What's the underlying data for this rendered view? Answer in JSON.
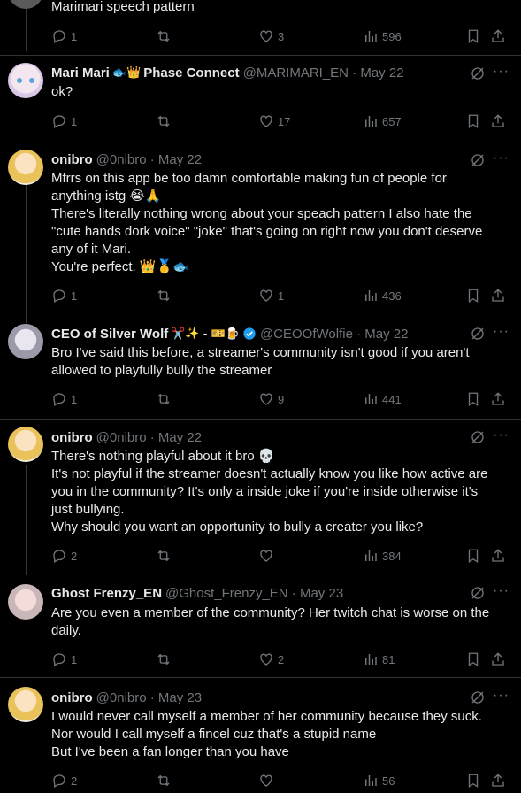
{
  "tweets": [
    {
      "id": "t0",
      "body": [
        "Marimari speech pattern"
      ],
      "stats": {
        "replies": "1",
        "reposts": "",
        "likes": "3",
        "views": "596"
      }
    },
    {
      "id": "t1",
      "name": "Mari Mari",
      "name_emoji": "🐟👑",
      "name_suffix": "Phase Connect",
      "handle": "@MARIMARI_EN · May 22",
      "body": [
        "ok?"
      ],
      "stats": {
        "replies": "1",
        "reposts": "",
        "likes": "17",
        "views": "657"
      }
    },
    {
      "id": "t2",
      "name": "onibro",
      "handle": "@0nibro · May 22",
      "body": [
        "Mfrrs on this app be too damn comfortable making fun of people for",
        "anything istg 😭🙏",
        "There's literally nothing wrong about your speach pattern I also hate the",
        "\"cute hands dork voice\" \"joke\" that's going on right now you don't deserve",
        "any of it Mari.",
        "You're perfect. 👑🥇🐟"
      ],
      "stats": {
        "replies": "1",
        "reposts": "",
        "likes": "1",
        "views": "436"
      }
    },
    {
      "id": "t3",
      "name": "CEO of Silver Wolf",
      "name_emoji": "✂️✨ - 🎫🍺",
      "verified": true,
      "handle": "@CEOOfWolfie · May 22",
      "body": [
        "Bro I've said this before, a streamer's community isn't good if you aren't",
        "allowed to playfully bully the streamer"
      ],
      "stats": {
        "replies": "1",
        "reposts": "",
        "likes": "9",
        "views": "441"
      }
    },
    {
      "id": "t4",
      "name": "onibro",
      "handle": "@0nibro · May 22",
      "body": [
        "There's nothing playful about it bro 💀",
        "It's not playful if the streamer doesn't actually know you like how active are",
        "you in the community? It's only a inside joke if you're inside otherwise it's",
        "just bullying.",
        "Why should you want an opportunity to bully a creater you like?"
      ],
      "stats": {
        "replies": "2",
        "reposts": "",
        "likes": "",
        "views": "384"
      }
    },
    {
      "id": "t5",
      "name": "Ghost Frenzy_EN",
      "handle": "@Ghost_Frenzy_EN · May 23",
      "body": [
        "Are you even a member of the community?  Her twitch chat is worse on the",
        "daily."
      ],
      "stats": {
        "replies": "1",
        "reposts": "",
        "likes": "2",
        "views": "81"
      }
    },
    {
      "id": "t6",
      "name": "onibro",
      "handle": "@0nibro · May 23",
      "body": [
        "I would never call myself a member of her community because they suck.",
        "Nor would I call myself a fincel cuz that's a stupid name",
        "But I've been a fan longer than you have"
      ],
      "stats": {
        "replies": "2",
        "reposts": "",
        "likes": "",
        "views": "56"
      }
    }
  ],
  "colors": {
    "background": "#000000",
    "text": "#e7e9ea",
    "muted": "#71767b",
    "divider": "#2f3336",
    "verified": "#1d9bf0"
  },
  "icons": {
    "reply": "reply-icon",
    "repost": "repost-icon",
    "like": "heart-icon",
    "views": "views-icon",
    "bookmark": "bookmark-icon",
    "share": "share-icon",
    "grok": "grok-icon",
    "more": "more-icon"
  }
}
